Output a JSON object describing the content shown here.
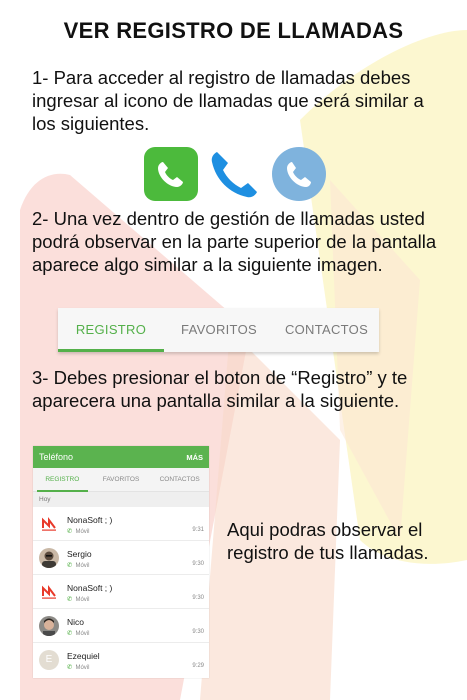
{
  "title": "VER REGISTRO DE LLAMADAS",
  "steps": {
    "step1": "1- Para acceder al registro de llamadas debes ingresar al icono de llamadas que será similar a los siguientes.",
    "step2": "2- Una vez dentro de gestión de llamadas usted podrá observar en la parte superior de la pantalla aparece algo similar a la siguiente imagen.",
    "step3": "3- Debes presionar el boton de “Registro” y te aparecera una pantalla similar a la siguiente."
  },
  "icons": [
    "phone-icon-green-square",
    "phone-icon-blue-handset",
    "phone-icon-blue-circle"
  ],
  "tabbar": {
    "tabs": [
      "REGISTRO",
      "FAVORITOS",
      "CONTACTOS"
    ],
    "active_index": 0,
    "accent_color": "#54b04a"
  },
  "phone": {
    "header_title": "Teléfono",
    "header_more": "MÁS",
    "tabs": [
      "REGISTRO",
      "FAVORITOS",
      "CONTACTOS"
    ],
    "section": "Hoy",
    "rows": [
      {
        "name": "NonaSoft ; )",
        "type": "Móvil",
        "time": "9:31",
        "avatar": "nonasoft-logo"
      },
      {
        "name": "Sergio",
        "type": "Móvil",
        "time": "9:30",
        "avatar": "photo"
      },
      {
        "name": "NonaSoft ; )",
        "type": "Móvil",
        "time": "9:30",
        "avatar": "nonasoft-logo"
      },
      {
        "name": "Nico",
        "type": "Móvil",
        "time": "9:30",
        "avatar": "photo"
      },
      {
        "name": "Ezequiel",
        "type": "Móvil",
        "time": "9:29",
        "avatar": "letter",
        "initial": "E"
      }
    ],
    "header_color": "#5bb34f"
  },
  "side_note": "Aqui podras observar el registro de tus llamadas."
}
